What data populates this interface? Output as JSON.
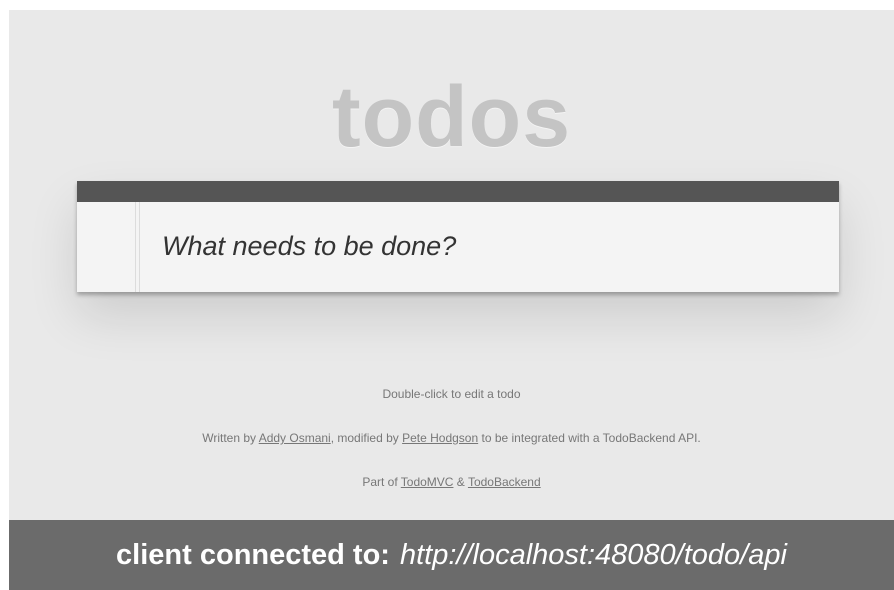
{
  "app": {
    "title": "todos"
  },
  "new_todo": {
    "placeholder": "What needs to be done?"
  },
  "info": {
    "hint": "Double-click to edit a todo",
    "credits_prefix": "Written by ",
    "author": "Addy Osmani",
    "credits_middle": ", modified by ",
    "modifier": "Pete Hodgson",
    "credits_suffix": " to be integrated with a TodoBackend API.",
    "part_of_prefix": "Part of ",
    "link_todomvc": "TodoMVC",
    "amp": " & ",
    "link_todobackend": "TodoBackend"
  },
  "status": {
    "label": "client connected to:",
    "url": "http://localhost:48080/todo/api"
  },
  "colors": {
    "background": "#e9e9e9",
    "header_bar": "#555555",
    "status_bar": "#6b6b6b",
    "title": "#c4c4c4"
  }
}
